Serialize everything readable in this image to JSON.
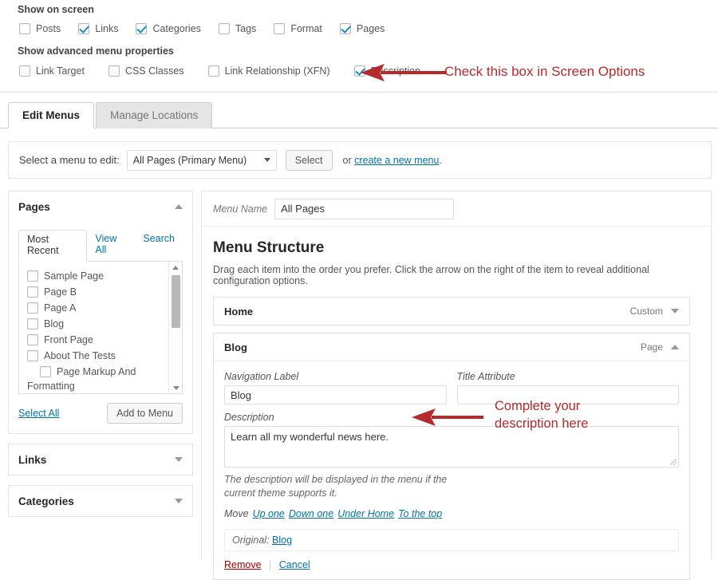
{
  "screen_options": {
    "show_on_screen_label": "Show on screen",
    "show_on_screen": [
      {
        "label": "Posts",
        "checked": false
      },
      {
        "label": "Links",
        "checked": true
      },
      {
        "label": "Categories",
        "checked": true
      },
      {
        "label": "Tags",
        "checked": false
      },
      {
        "label": "Format",
        "checked": false
      },
      {
        "label": "Pages",
        "checked": true
      }
    ],
    "advanced_label": "Show advanced menu properties",
    "advanced": [
      {
        "label": "Link Target",
        "checked": false
      },
      {
        "label": "CSS Classes",
        "checked": false
      },
      {
        "label": "Link Relationship (XFN)",
        "checked": false
      },
      {
        "label": "Description",
        "checked": true
      }
    ]
  },
  "annotations": {
    "color": "#b52a2a",
    "top_note": "Check this box in Screen Options",
    "description_note_line1": "Complete your",
    "description_note_line2": "description here"
  },
  "tabs": [
    {
      "label": "Edit Menus",
      "active": true
    },
    {
      "label": "Manage Locations",
      "active": false
    }
  ],
  "menu_select_bar": {
    "label": "Select a menu to edit:",
    "selected_menu": "All Pages (Primary Menu)",
    "select_button": "Select",
    "or_text": "or",
    "create_link": "create a new menu",
    "trailing_period": "."
  },
  "sidebar": {
    "pages_panel": {
      "title": "Pages",
      "tabs": [
        {
          "label": "Most Recent",
          "active": true
        },
        {
          "label": "View All",
          "active": false
        },
        {
          "label": "Search",
          "active": false
        }
      ],
      "items": [
        {
          "label": "Sample Page",
          "checked": false,
          "indent": false
        },
        {
          "label": "Page B",
          "checked": false,
          "indent": false
        },
        {
          "label": "Page A",
          "checked": false,
          "indent": false
        },
        {
          "label": "Blog",
          "checked": false,
          "indent": false
        },
        {
          "label": "Front Page",
          "checked": false,
          "indent": false
        },
        {
          "label": "About The Tests",
          "checked": false,
          "indent": false
        },
        {
          "label": "Page Markup And",
          "checked": false,
          "indent": true
        }
      ],
      "wrapped_text": "Formatting",
      "select_all": "Select All",
      "add_to_menu": "Add to Menu"
    },
    "collapsed_panels": [
      {
        "title": "Links"
      },
      {
        "title": "Categories"
      }
    ]
  },
  "main": {
    "menu_name_label": "Menu Name",
    "menu_name_value": "All Pages",
    "structure_title": "Menu Structure",
    "structure_help": "Drag each item into the order you prefer. Click the arrow on the right of the item to reveal additional configuration options.",
    "items": [
      {
        "title": "Home",
        "type": "Custom",
        "expanded": false
      },
      {
        "title": "Blog",
        "type": "Page",
        "expanded": true
      }
    ],
    "blog_item": {
      "nav_label_label": "Navigation Label",
      "nav_label_value": "Blog",
      "title_attr_label": "Title Attribute",
      "title_attr_value": "",
      "description_label": "Description",
      "description_value": "Learn all my wonderful news here.",
      "description_hint": "The description will be displayed in the menu if the current theme supports it.",
      "move_label": "Move",
      "move_links": [
        "Up one",
        "Down one",
        "Under Home",
        "To the top"
      ],
      "original_label": "Original:",
      "original_link": "Blog",
      "remove_label": "Remove",
      "separator": "|",
      "cancel_label": "Cancel"
    }
  }
}
